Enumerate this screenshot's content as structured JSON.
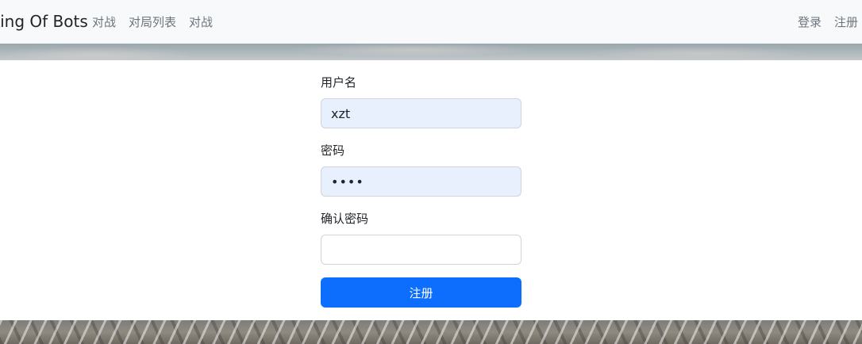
{
  "navbar": {
    "brand": "King Of Bots",
    "left_links": [
      "对战",
      "对局列表",
      "对战"
    ],
    "right_links": [
      "登录",
      "注册"
    ]
  },
  "form": {
    "username_label": "用户名",
    "username_value": "xzt",
    "password_label": "密码",
    "password_value": "••••",
    "confirm_label": "确认密码",
    "confirm_value": "",
    "submit_label": "注册"
  },
  "colors": {
    "navbar_bg": "#f8f9fa",
    "autofill_bg": "#e8f0fe",
    "primary": "#0d6efd"
  }
}
